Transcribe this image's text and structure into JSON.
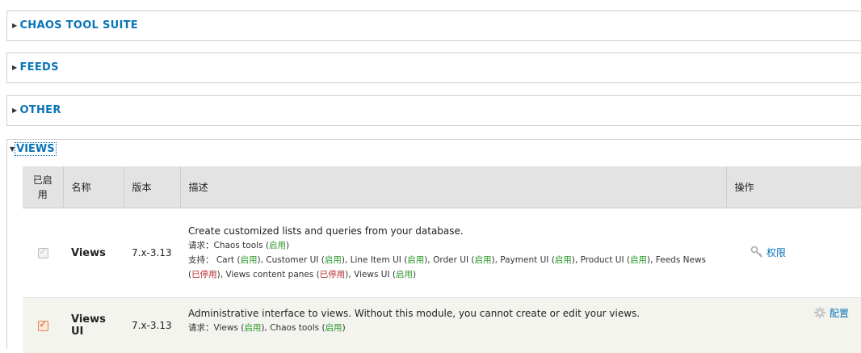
{
  "fieldsets": [
    {
      "label": "CHAOS TOOL SUITE"
    },
    {
      "label": "FEEDS"
    },
    {
      "label": "OTHER"
    }
  ],
  "views_fieldset": {
    "label": "VIEWS"
  },
  "table": {
    "headers": {
      "enabled_line1": "已启",
      "enabled_line2": "用",
      "name": "名称",
      "version": "版本",
      "description": "描述",
      "operations": "操作"
    },
    "rows": [
      {
        "name": "Views",
        "version": "7.x-3.13",
        "description": "Create customized lists and queries from your database.",
        "requires_prefix": "请求：",
        "requires": [
          {
            "name": "Chaos tools",
            "status": "启用"
          }
        ],
        "supports_prefix": "支持：",
        "supports": [
          {
            "name": "Cart",
            "status": "启用"
          },
          {
            "name": "Customer UI",
            "status": "启用"
          },
          {
            "name": "Line Item UI",
            "status": "启用"
          },
          {
            "name": "Order UI",
            "status": "启用"
          },
          {
            "name": "Payment UI",
            "status": "启用"
          },
          {
            "name": "Product UI",
            "status": "启用"
          },
          {
            "name": "Feeds News",
            "status": "已停用"
          },
          {
            "name": "Views content panes",
            "status": "已停用"
          },
          {
            "name": "Views UI",
            "status": "启用"
          }
        ],
        "operation": "权限",
        "operation_icon": "key-icon"
      },
      {
        "name_line1": "Views",
        "name_line2": "UI",
        "version": "7.x-3.13",
        "description": "Administrative interface to views. Without this module, you cannot create or edit your views.",
        "requires_prefix": "请求：",
        "requires": [
          {
            "name": "Views",
            "status": "启用"
          },
          {
            "name": "Chaos tools",
            "status": "启用"
          }
        ],
        "operation": "配置",
        "operation_icon": "gear-icon"
      }
    ]
  },
  "colors": {
    "link": "#0a74b8",
    "enabled": "#2c9a2c",
    "disabled": "#b42b2b",
    "header_bg": "#e3e3e3",
    "row_highlight": "#f3f4ee"
  }
}
